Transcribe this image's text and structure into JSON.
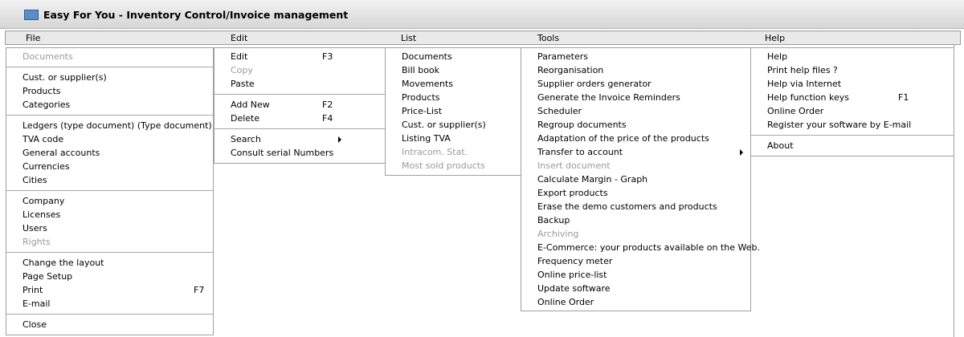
{
  "window": {
    "title": "Easy For You - Inventory Control/Invoice management",
    "icon": "app-logo-icon"
  },
  "menubar": {
    "file": "File",
    "edit": "Edit",
    "list": "List",
    "tools": "Tools",
    "help": "Help"
  },
  "menus": {
    "file": [
      {
        "label": "Documents",
        "disabled": true
      },
      {
        "sep": true
      },
      {
        "label": "Cust. or supplier(s)"
      },
      {
        "label": "Products"
      },
      {
        "label": "Categories"
      },
      {
        "sep": true
      },
      {
        "label": "Ledgers (type document) (Type document)"
      },
      {
        "label": "TVA code"
      },
      {
        "label": "General accounts"
      },
      {
        "label": "Currencies"
      },
      {
        "label": "Cities"
      },
      {
        "sep": true
      },
      {
        "label": "Company"
      },
      {
        "label": "Licenses"
      },
      {
        "label": "Users"
      },
      {
        "label": "Rights",
        "disabled": true
      },
      {
        "sep": true
      },
      {
        "label": "Change the layout"
      },
      {
        "label": "Page Setup"
      },
      {
        "label": "Print",
        "shortcut": "F7"
      },
      {
        "label": "E-mail"
      },
      {
        "sep": true
      },
      {
        "label": "Close"
      }
    ],
    "edit": [
      {
        "label": "Edit",
        "shortcut": "F3"
      },
      {
        "label": "Copy",
        "disabled": true
      },
      {
        "label": "Paste"
      },
      {
        "sep": true
      },
      {
        "label": "Add New",
        "shortcut": "F2"
      },
      {
        "label": "Delete",
        "shortcut": "F4"
      },
      {
        "sep": true
      },
      {
        "label": "Search",
        "submenu": true
      },
      {
        "label": "Consult serial Numbers"
      }
    ],
    "list": [
      {
        "label": "Documents"
      },
      {
        "label": "Bill book"
      },
      {
        "label": "Movements"
      },
      {
        "label": "Products"
      },
      {
        "label": "Price-List"
      },
      {
        "label": "Cust. or supplier(s)"
      },
      {
        "label": "Listing TVA"
      },
      {
        "label": "Intracom. Stat.",
        "disabled": true
      },
      {
        "label": "Most sold products",
        "disabled": true
      }
    ],
    "tools": [
      {
        "label": "Parameters"
      },
      {
        "label": "Reorganisation"
      },
      {
        "label": "Supplier orders generator"
      },
      {
        "label": "Generate the Invoice Reminders"
      },
      {
        "label": "Scheduler"
      },
      {
        "label": "Regroup documents"
      },
      {
        "label": "Adaptation of the price of the products"
      },
      {
        "label": "Transfer to account",
        "submenu": true
      },
      {
        "label": "Insert document",
        "disabled": true
      },
      {
        "label": "Calculate Margin - Graph"
      },
      {
        "label": "Export products"
      },
      {
        "label": "Erase the demo customers and products"
      },
      {
        "label": "Backup"
      },
      {
        "label": "Archiving",
        "disabled": true
      },
      {
        "label": "E-Commerce: your products available on the Web."
      },
      {
        "label": "Frequency meter"
      },
      {
        "label": "Online price-list"
      },
      {
        "label": "Update software"
      },
      {
        "label": "Online Order"
      }
    ],
    "help": [
      {
        "label": "Help"
      },
      {
        "label": "Print help files ?"
      },
      {
        "label": "Help via Internet"
      },
      {
        "label": "Help function keys",
        "shortcut": "F1"
      },
      {
        "label": "Online Order"
      },
      {
        "label": "Register your software by E-mail"
      },
      {
        "sep": true
      },
      {
        "label": "About"
      }
    ]
  }
}
